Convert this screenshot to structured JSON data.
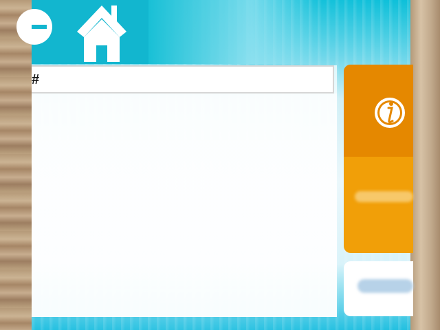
{
  "icons": {
    "back": "minus-circle-icon",
    "home": "home-icon",
    "info": "info-icon"
  },
  "table": {
    "columns": [
      "#",
      "",
      "",
      ""
    ]
  },
  "colors": {
    "teal": "#12b6cf",
    "orange": "#f19f08",
    "orange_dark": "#e58800",
    "white": "#ffffff"
  }
}
